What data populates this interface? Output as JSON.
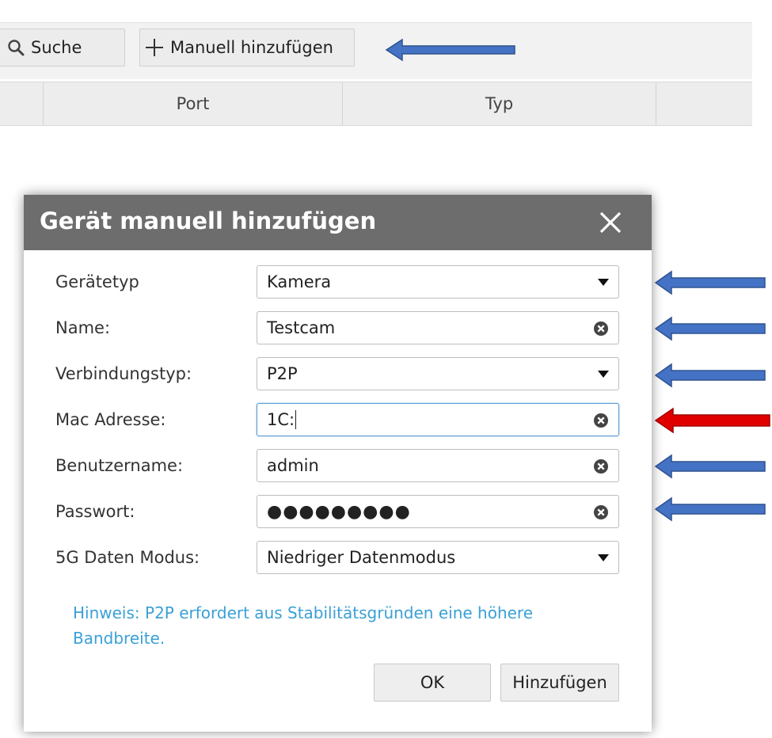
{
  "toolbar": {
    "search_label": "Suche",
    "search_icon": "search-icon",
    "add_manual_label": "Manuell hinzufügen",
    "add_icon": "plus-icon"
  },
  "table": {
    "columns": [
      "",
      "Port",
      "Typ",
      ""
    ]
  },
  "dialog": {
    "title": "Gerät manuell hinzufügen",
    "close_icon": "close-icon",
    "fields": [
      {
        "label": "Gerätetyp",
        "value": "Kamera",
        "kind": "select"
      },
      {
        "label": "Name:",
        "value": "Testcam",
        "kind": "input"
      },
      {
        "label": "Verbindungstyp:",
        "value": "P2P",
        "kind": "select"
      },
      {
        "label": "Mac Adresse:",
        "value": "1C:",
        "kind": "input",
        "focused": true
      },
      {
        "label": "Benutzername:",
        "value": "admin",
        "kind": "input"
      },
      {
        "label": "Passwort:",
        "value": "●●●●●●●●●",
        "kind": "password"
      },
      {
        "label": "5G Daten Modus:",
        "value": "Niedriger Datenmodus",
        "kind": "select"
      }
    ],
    "hint": "Hinweis: P2P erfordert aus Stabilitätsgründen eine höhere Bandbreite.",
    "ok_label": "OK",
    "add_label": "Hinzufügen"
  },
  "annotations": {
    "arrow_color_primary": "#4472c4",
    "arrow_color_highlight": "#e00000",
    "arrow_icon": "left-arrow-icon"
  }
}
